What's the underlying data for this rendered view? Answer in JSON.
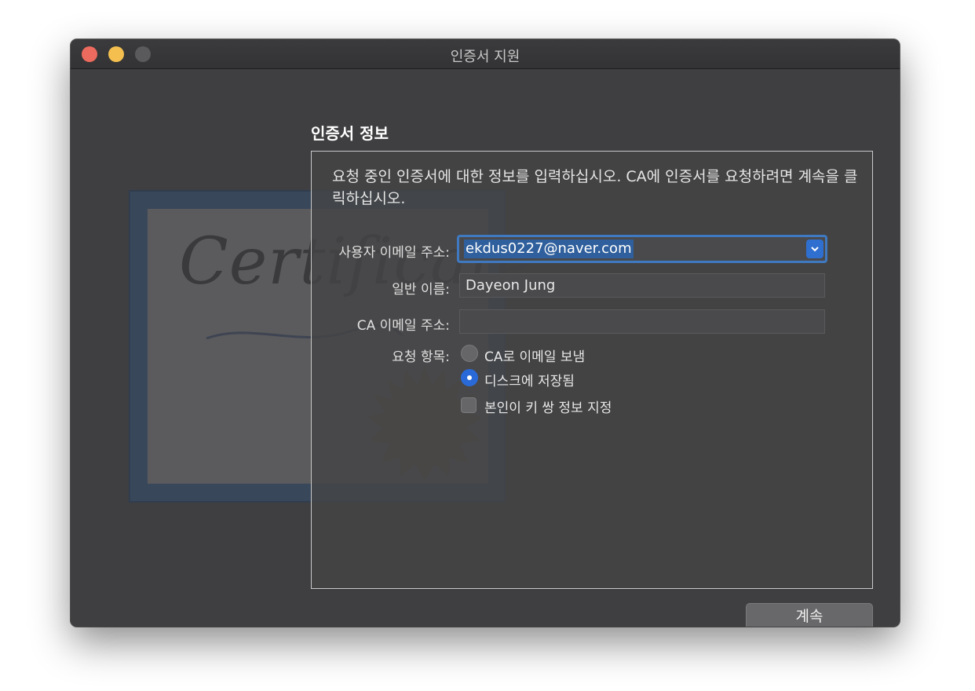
{
  "window": {
    "title": "인증서 지원"
  },
  "illustration": {
    "word": "Certificate"
  },
  "section": {
    "title": "인증서 정보"
  },
  "description": "요청 중인 인증서에 대한 정보를 입력하십시오. CA에 인증서를 요청하려면 계속을 클릭하십시오.",
  "form": {
    "email_label": "사용자 이메일 주소:",
    "email_value": "ekdus0227@naver.com",
    "common_name_label": "일반 이름:",
    "common_name_value": "Dayeon Jung",
    "ca_email_label": "CA 이메일 주소:",
    "ca_email_value": "",
    "request_label": "요청 항목:",
    "options": [
      "CA로 이메일 보냄",
      "디스크에 저장됨"
    ],
    "selected_option": "디스크에 저장됨",
    "keypair_label": "본인이 키 쌍 정보 지정",
    "keypair_checked": false
  },
  "buttons": {
    "continue": "계속"
  },
  "colors": {
    "accent": "#2a6ad8",
    "close": "#ed6a5e",
    "minimize": "#f4bf4f"
  },
  "icons": [
    "close-icon",
    "minimize-icon",
    "maximize-icon",
    "chevron-down-icon"
  ]
}
